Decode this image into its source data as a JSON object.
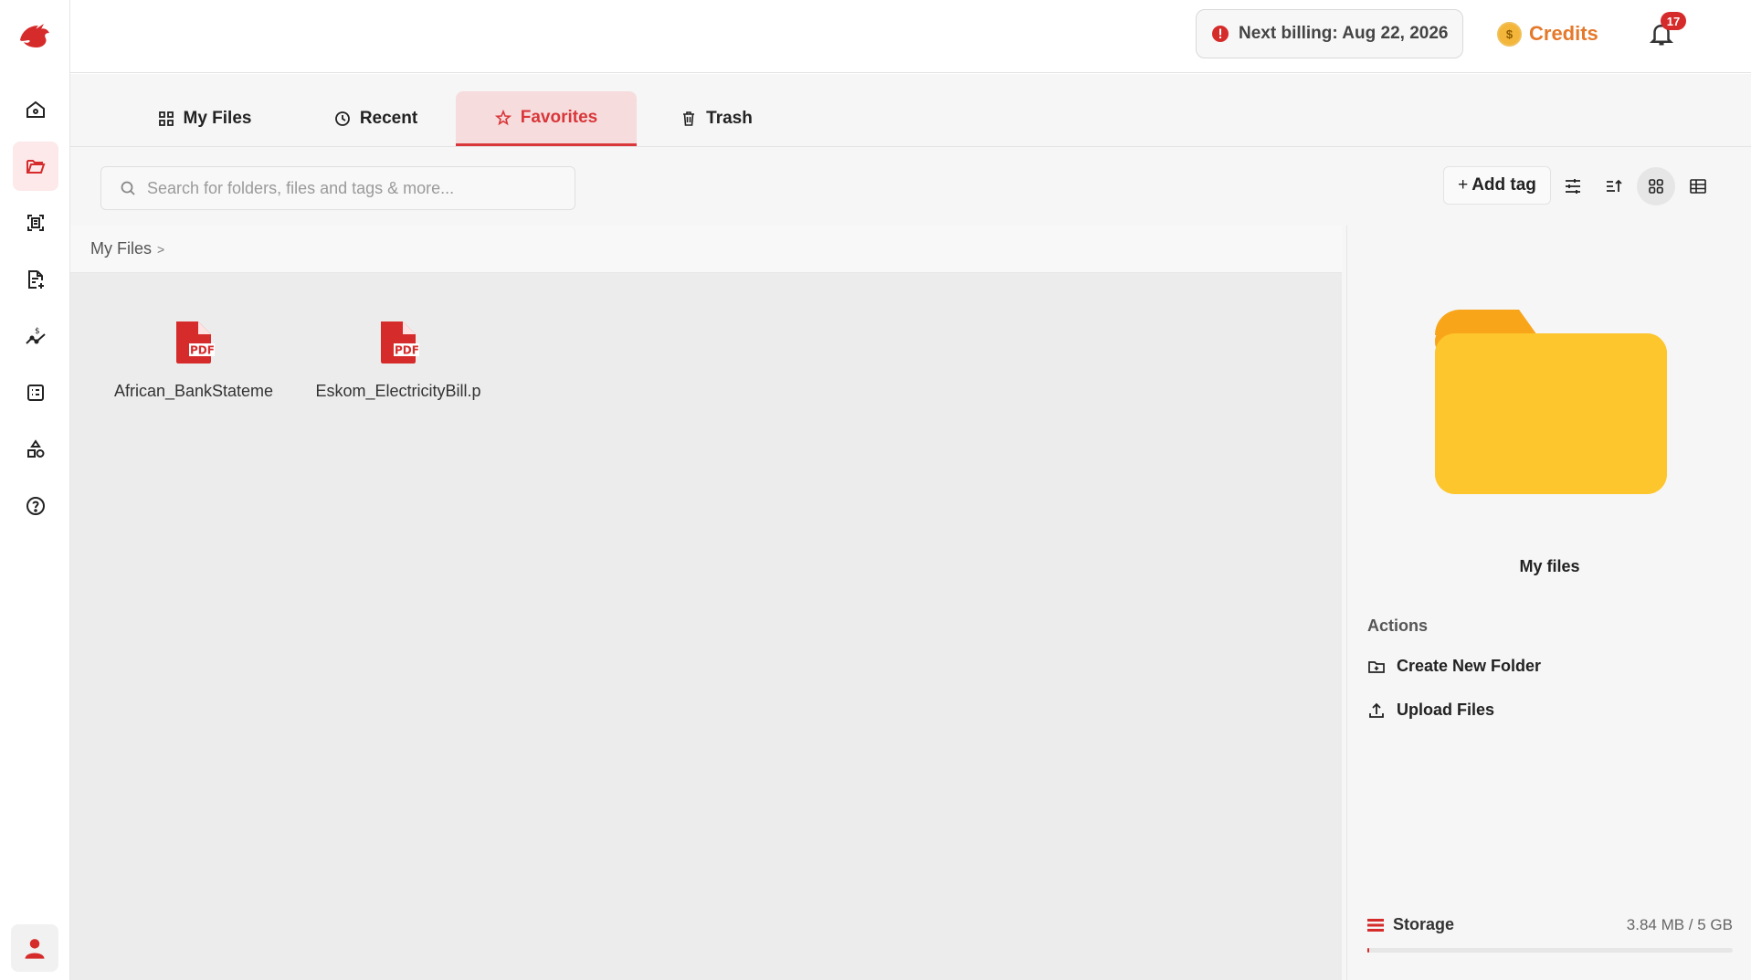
{
  "header": {
    "billing_text": "Next billing: Aug 22, 2026",
    "credits_label": "Credits",
    "coin_symbol": "$",
    "notification_count": "17"
  },
  "sidebar": {
    "items": [
      {
        "icon": "home-icon"
      },
      {
        "icon": "folder-open-icon",
        "active": true
      },
      {
        "icon": "scan-document-icon"
      },
      {
        "icon": "document-add-icon"
      },
      {
        "icon": "money-chart-icon"
      },
      {
        "icon": "checklist-icon"
      },
      {
        "icon": "shapes-icon"
      },
      {
        "icon": "help-circle-icon"
      }
    ],
    "user_icon": "user-avatar-icon"
  },
  "tabs": [
    {
      "label": "My Files",
      "icon": "grid-icon"
    },
    {
      "label": "Recent",
      "icon": "clock-icon"
    },
    {
      "label": "Favorites",
      "icon": "star-icon",
      "active": true
    },
    {
      "label": "Trash",
      "icon": "trash-icon"
    }
  ],
  "search": {
    "placeholder": "Search for folders, files and tags & more..."
  },
  "toolbar": {
    "add_tag_label": "Add tag",
    "add_tag_prefix": "+",
    "view_mode": "grid"
  },
  "breadcrumb": {
    "root": "My Files",
    "separator": ">"
  },
  "files": [
    {
      "name": "African_BankStateme",
      "type": "PDF"
    },
    {
      "name": "Eskom_ElectricityBill.p",
      "type": "PDF"
    }
  ],
  "details_panel": {
    "title": "My files",
    "actions_title": "Actions",
    "actions": [
      {
        "label": "Create New Folder",
        "icon": "folder-plus-icon"
      },
      {
        "label": "Upload Files",
        "icon": "upload-icon"
      }
    ],
    "storage_label": "Storage",
    "storage_value": "3.84 MB / 5 GB",
    "storage_used_fraction": 0.00075
  },
  "colors": {
    "accent": "#d9373a",
    "credits": "#e5792b",
    "folder": "#fcc62c",
    "folder_tab": "#f8a51a"
  }
}
